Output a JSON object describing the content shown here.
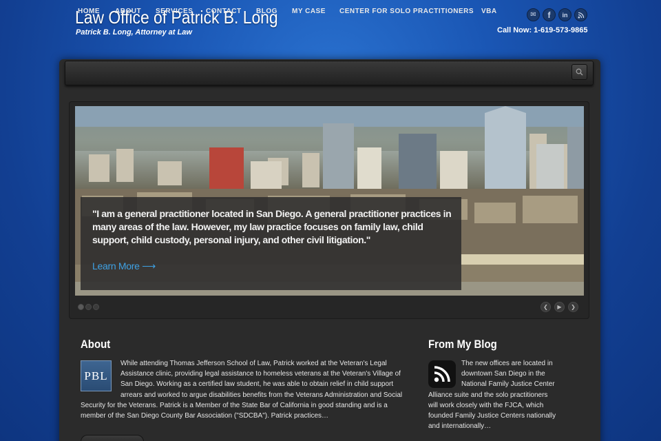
{
  "header": {
    "title": "Law Office of Patrick B. Long",
    "tagline": "Patrick B. Long, Attorney at Law",
    "phone": "Call Now: 1-619-573-9865",
    "social_icons": [
      "email-icon",
      "facebook-icon",
      "linkedin-icon",
      "rss-icon"
    ]
  },
  "nav": {
    "items": [
      {
        "label": "HOME"
      },
      {
        "label": "ABOUT"
      },
      {
        "label": "SERVICES"
      },
      {
        "label": "CONTACT"
      },
      {
        "label": "BLOG"
      },
      {
        "label": "MY CASE"
      },
      {
        "label": "CENTER FOR SOLO PRACTITIONERS"
      },
      {
        "label": "VBA"
      }
    ],
    "search_icon": "search-icon"
  },
  "slider": {
    "caption": "\"I am a general practitioner located in San Diego. A general practitioner practices in many areas of the law. However, my law practice focuses on family law, child support, child custody, personal injury, and other civil litigation.\"",
    "learn_more": "Learn More ⟶",
    "slide_count": 3,
    "active_slide": 1
  },
  "about": {
    "heading": "About",
    "logo_text": "PBL",
    "text": "While attending Thomas Jefferson School of Law, Patrick worked at the Veteran's Legal Assistance clinic, providing legal assistance to homeless veterans at the Veteran's Village of San Diego. Working as a certified law student, he was able to obtain relief in child support arrears and worked to argue disabilities benefits from the Veterans Administration and Social Security for the Veterans. Patrick is a Member of the State Bar of California in good standing and is a member of the San Diego County Bar Association (\"SDCBA\"). Patrick practices…"
  },
  "blog": {
    "heading": "From My Blog",
    "text": "The new offices are located in downtown San Diego in the National Family Justice Center Alliance suite and the solo practitioners will work closely with the FJCA, which founded Family Justice Centers nationally and internationally…"
  },
  "colors": {
    "background": "#1a56b4",
    "panel": "#2b2b2b",
    "link": "#3ea1e4"
  }
}
